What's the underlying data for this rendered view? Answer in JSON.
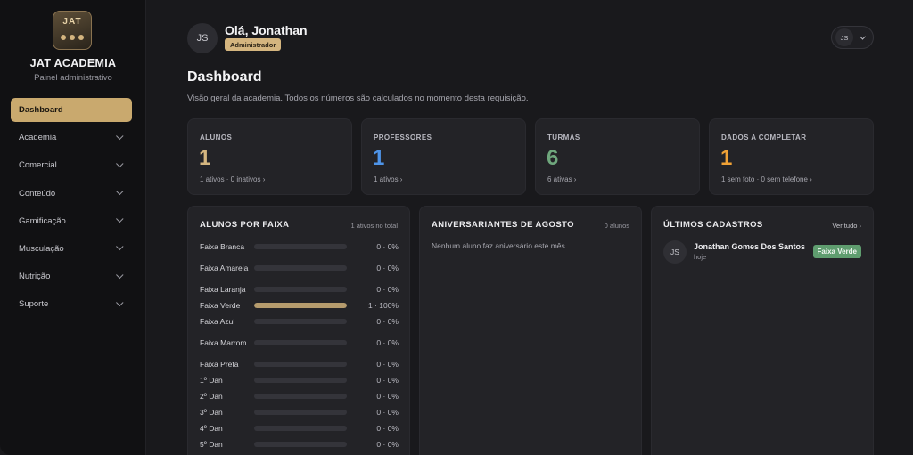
{
  "sidebar": {
    "logo_text": "JAT",
    "brand": "JAT ACADEMIA",
    "subtitle": "Painel administrativo",
    "items": [
      {
        "label": "Dashboard",
        "active": true
      },
      {
        "label": "Academia"
      },
      {
        "label": "Comercial"
      },
      {
        "label": "Conteúdo"
      },
      {
        "label": "Gamificação"
      },
      {
        "label": "Musculação"
      },
      {
        "label": "Nutrição"
      },
      {
        "label": "Suporte"
      }
    ]
  },
  "header": {
    "avatar_initials": "JS",
    "greeting": "Olá, Jonathan",
    "role": "Administrador",
    "user_menu_initials": "JS"
  },
  "page": {
    "title": "Dashboard",
    "description": "Visão geral da academia. Todos os números são calculados no momento desta requisição."
  },
  "stats": [
    {
      "label": "ALUNOS",
      "value": "1",
      "sub": "1 ativos · 0 inativos ›",
      "color": "#d4b57f"
    },
    {
      "label": "PROFESSORES",
      "value": "1",
      "sub": "1 ativos ›",
      "color": "#4e94e8"
    },
    {
      "label": "TURMAS",
      "value": "6",
      "sub": "6 ativas ›",
      "color": "#6fa77d"
    },
    {
      "label": "DADOS A COMPLETAR",
      "value": "1",
      "sub": "1 sem foto · 0 sem telefone ›",
      "color": "#f0a236"
    }
  ],
  "belts": {
    "title": "ALUNOS POR FAIXA",
    "meta": "1 ativos no total",
    "rows": [
      {
        "name": "Faixa Branca",
        "value": "0 · 0%",
        "percent": 0
      },
      {
        "name": "Faixa Amarela",
        "value": "0 · 0%",
        "percent": 0
      },
      {
        "name": "Faixa Laranja",
        "value": "0 · 0%",
        "percent": 0
      },
      {
        "name": "Faixa Verde",
        "value": "1 · 100%",
        "percent": 100
      },
      {
        "name": "Faixa Azul",
        "value": "0 · 0%",
        "percent": 0
      },
      {
        "name": "Faixa Marrom",
        "value": "0 · 0%",
        "percent": 0
      },
      {
        "name": "Faixa Preta",
        "value": "0 · 0%",
        "percent": 0
      },
      {
        "name": "1º Dan",
        "value": "0 · 0%",
        "percent": 0
      },
      {
        "name": "2º Dan",
        "value": "0 · 0%",
        "percent": 0
      },
      {
        "name": "3º Dan",
        "value": "0 · 0%",
        "percent": 0
      },
      {
        "name": "4º Dan",
        "value": "0 · 0%",
        "percent": 0
      },
      {
        "name": "5º Dan",
        "value": "0 · 0%",
        "percent": 0
      }
    ]
  },
  "birthdays": {
    "title": "ANIVERSARIANTES DE AGOSTO",
    "meta": "0 alunos",
    "empty": "Nenhum aluno faz aniversário este mês."
  },
  "recent": {
    "title": "ÚLTIMOS CADASTROS",
    "link": "Ver tudo ›",
    "items": [
      {
        "initials": "JS",
        "name": "Jonathan Gomes Dos Santos",
        "time": "hoje",
        "badge": "Faixa Verde"
      }
    ]
  }
}
